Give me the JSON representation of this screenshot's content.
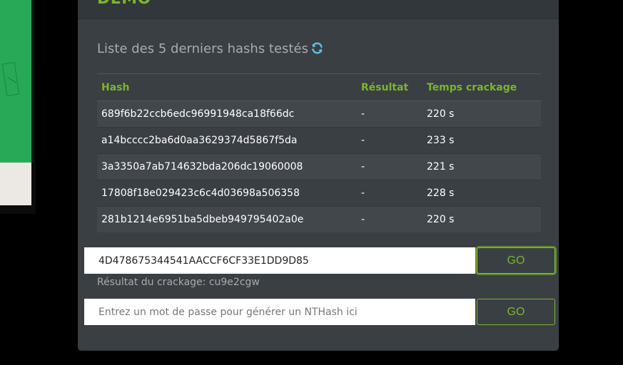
{
  "panel": {
    "title": "DEMO",
    "section_title": "Liste des 5 derniers hashs testés"
  },
  "table": {
    "headers": {
      "hash": "Hash",
      "result": "Résultat",
      "time": "Temps crackage"
    },
    "rows": [
      {
        "hash": "689f6b22ccb6edc96991948ca18f66dc",
        "result": "-",
        "time": "220 s"
      },
      {
        "hash": "a14bcccc2ba6d0aa3629374d5867f5da",
        "result": "-",
        "time": "233 s"
      },
      {
        "hash": "3a3350a7ab714632bda206dc19060008",
        "result": "-",
        "time": "221 s"
      },
      {
        "hash": "17808f18e029423c6c4d03698a506358",
        "result": "-",
        "time": "228 s"
      },
      {
        "hash": "281b1214e6951ba5dbeb949795402a0e",
        "result": "-",
        "time": "220 s"
      }
    ]
  },
  "crack_form": {
    "value": "4D478675344541AACCF6CF33E1DD9D85",
    "button_label": "GO",
    "result_text": "Résultat du crackage: cu9e2cgw"
  },
  "generate_form": {
    "placeholder": "Entrez un mot de passe pour générer un NTHash ici",
    "value": "",
    "button_label": "GO"
  },
  "colors": {
    "accent": "#7bb52c",
    "panel_bg": "#3a3f44",
    "row_stripe": "#42474c",
    "refresh_icon": "#5bc0de"
  },
  "icons": {
    "refresh": "refresh-icon"
  }
}
